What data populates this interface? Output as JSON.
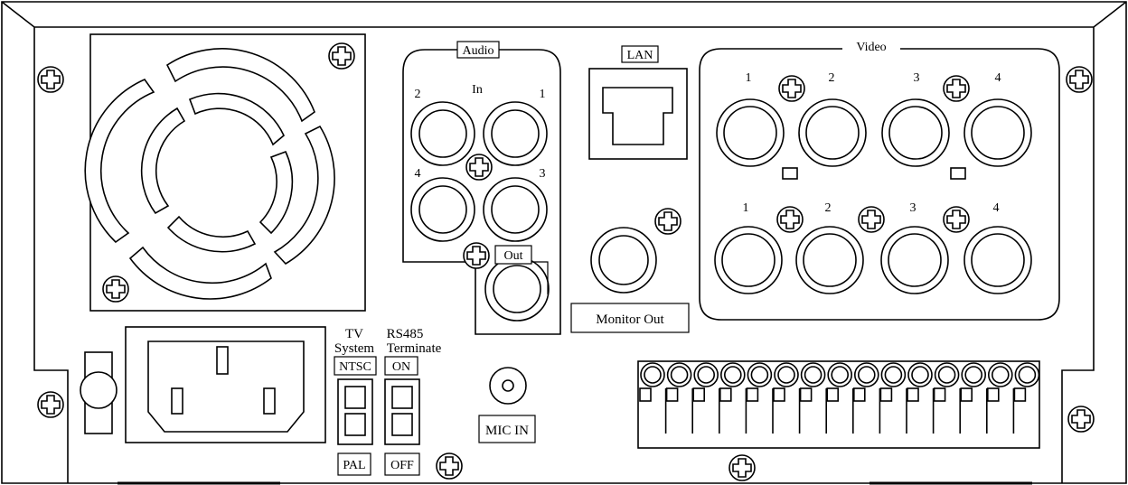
{
  "labels": {
    "audio": "Audio",
    "audio_in": "In",
    "audio_out": "Out",
    "lan": "LAN",
    "video": "Video",
    "monitor_out": "Monitor Out",
    "mic_in": "MIC IN",
    "tv": "TV",
    "system": "System",
    "rs485": "RS485",
    "terminate": "Terminate",
    "ntsc": "NTSC",
    "pal": "PAL",
    "on": "ON",
    "off": "OFF"
  },
  "audio_in_channels": [
    "2",
    "1",
    "4",
    "3"
  ],
  "video_top_channels": [
    "1",
    "2",
    "3",
    "4"
  ],
  "video_bottom_channels": [
    "1",
    "2",
    "3",
    "4"
  ],
  "terminal_count": 15,
  "colors": {
    "line": "#000000",
    "background": "#ffffff",
    "panel_fill": "#ffffff"
  }
}
